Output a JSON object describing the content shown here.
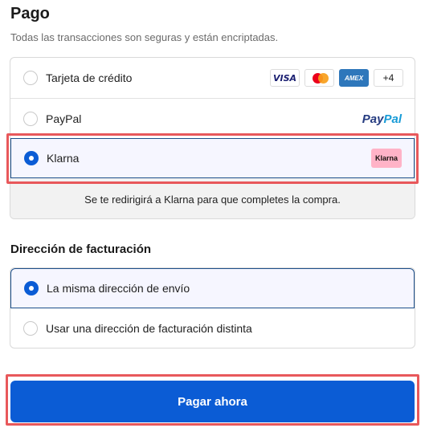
{
  "header": {
    "title": "Pago",
    "subtitle": "Todas las transacciones son seguras y están encriptadas."
  },
  "payment_methods": {
    "options": [
      {
        "label": "Tarjeta de crédito",
        "selected": false
      },
      {
        "label": "PayPal",
        "selected": false
      },
      {
        "label": "Klarna",
        "selected": true
      }
    ],
    "card_logos": {
      "visa": "VISA",
      "amex": "AMEX",
      "more": "+4"
    },
    "paypal_logo": {
      "part1": "Pay",
      "part2": "Pal"
    },
    "klarna_logo": "Klarna",
    "redirect_note": "Se te redirigirá a Klarna para que completes la compra."
  },
  "billing": {
    "title": "Dirección de facturación",
    "options": [
      {
        "label": "La misma dirección de envío",
        "selected": true
      },
      {
        "label": "Usar una dirección de facturación distinta",
        "selected": false
      }
    ]
  },
  "actions": {
    "pay_label": "Pagar ahora"
  },
  "colors": {
    "accent": "#0b5cd5",
    "highlight": "#e8585b",
    "klarna_pink": "#ffb3c7"
  }
}
